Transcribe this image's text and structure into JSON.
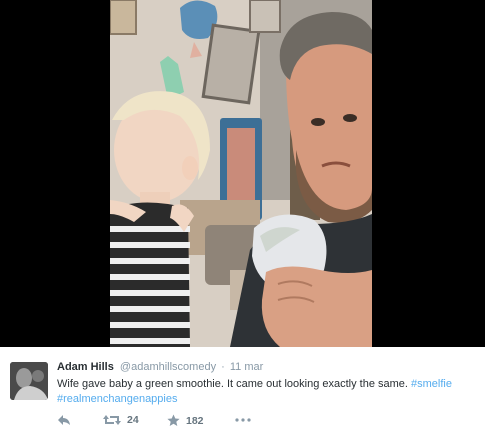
{
  "tweet": {
    "display_name": "Adam Hills",
    "screen_name": "@adamhillscomedy",
    "separator": "·",
    "timestamp": "11 mar",
    "text_main": "Wife gave baby a green smoothie. It came out looking exactly the same. ",
    "hashtag_1": "#smelfie",
    "hashtag_2": "#realmenchangenappies"
  },
  "actions": {
    "reply_icon": "reply-icon",
    "retweet_icon": "retweet-icon",
    "retweet_count": "24",
    "favorite_icon": "star-icon",
    "favorite_count": "182",
    "more_icon": "more-dots-icon"
  },
  "colors": {
    "link": "#55acee",
    "meta": "#8899a6",
    "media_background": "#000000"
  }
}
